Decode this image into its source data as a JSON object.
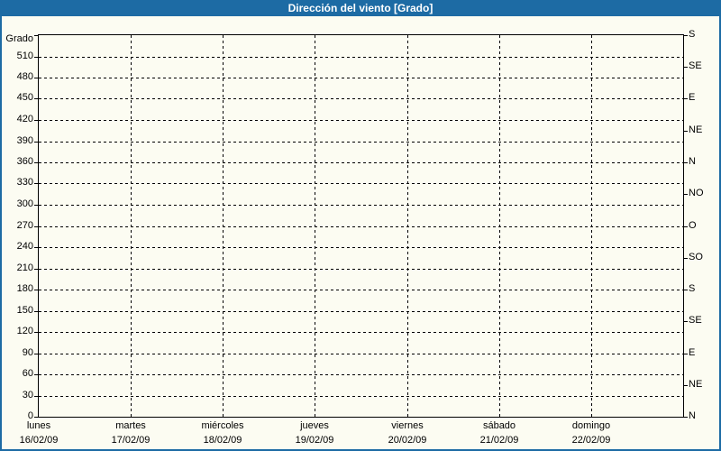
{
  "window": {
    "title": "Dirección del viento [Grado]"
  },
  "colors": {
    "titlebar_bg": "#1d6ba4",
    "titlebar_text": "#ffffff",
    "frame_border": "#1d6ba4",
    "background": "#fcfcf2",
    "plot_border": "#000000",
    "grid": "#000000",
    "label_text": "#000000"
  },
  "chart_data": {
    "type": "line",
    "title": "Dirección del viento [Grado]",
    "ylabel": "Grado",
    "ylim": [
      0,
      540
    ],
    "y_tick_step": 30,
    "y_tick_labels": [
      "0",
      "30",
      "60",
      "90",
      "120",
      "150",
      "180",
      "210",
      "240",
      "270",
      "300",
      "330",
      "360",
      "390",
      "420",
      "450",
      "480",
      "510"
    ],
    "right_axis": {
      "unit": "compass",
      "step_deg": 45,
      "ticks": [
        {
          "deg": 0,
          "label": "N"
        },
        {
          "deg": 45,
          "label": "NE"
        },
        {
          "deg": 90,
          "label": "E"
        },
        {
          "deg": 135,
          "label": "SE"
        },
        {
          "deg": 180,
          "label": "S"
        },
        {
          "deg": 225,
          "label": "SO"
        },
        {
          "deg": 270,
          "label": "O"
        },
        {
          "deg": 315,
          "label": "NO"
        },
        {
          "deg": 360,
          "label": "N"
        },
        {
          "deg": 405,
          "label": "NE"
        },
        {
          "deg": 450,
          "label": "E"
        },
        {
          "deg": 495,
          "label": "SE"
        },
        {
          "deg": 540,
          "label": "S"
        }
      ]
    },
    "x_categories": [
      {
        "day": "lunes",
        "date": "16/02/09"
      },
      {
        "day": "martes",
        "date": "17/02/09"
      },
      {
        "day": "miércoles",
        "date": "18/02/09"
      },
      {
        "day": "jueves",
        "date": "19/02/09"
      },
      {
        "day": "viernes",
        "date": "20/02/09"
      },
      {
        "day": "sábado",
        "date": "21/02/09"
      },
      {
        "day": "domingo",
        "date": "22/02/09"
      }
    ],
    "series": [],
    "grid": {
      "style": "dashed",
      "horizontal_every_deg": 30,
      "vertical_every": "day"
    },
    "legend": "none"
  }
}
